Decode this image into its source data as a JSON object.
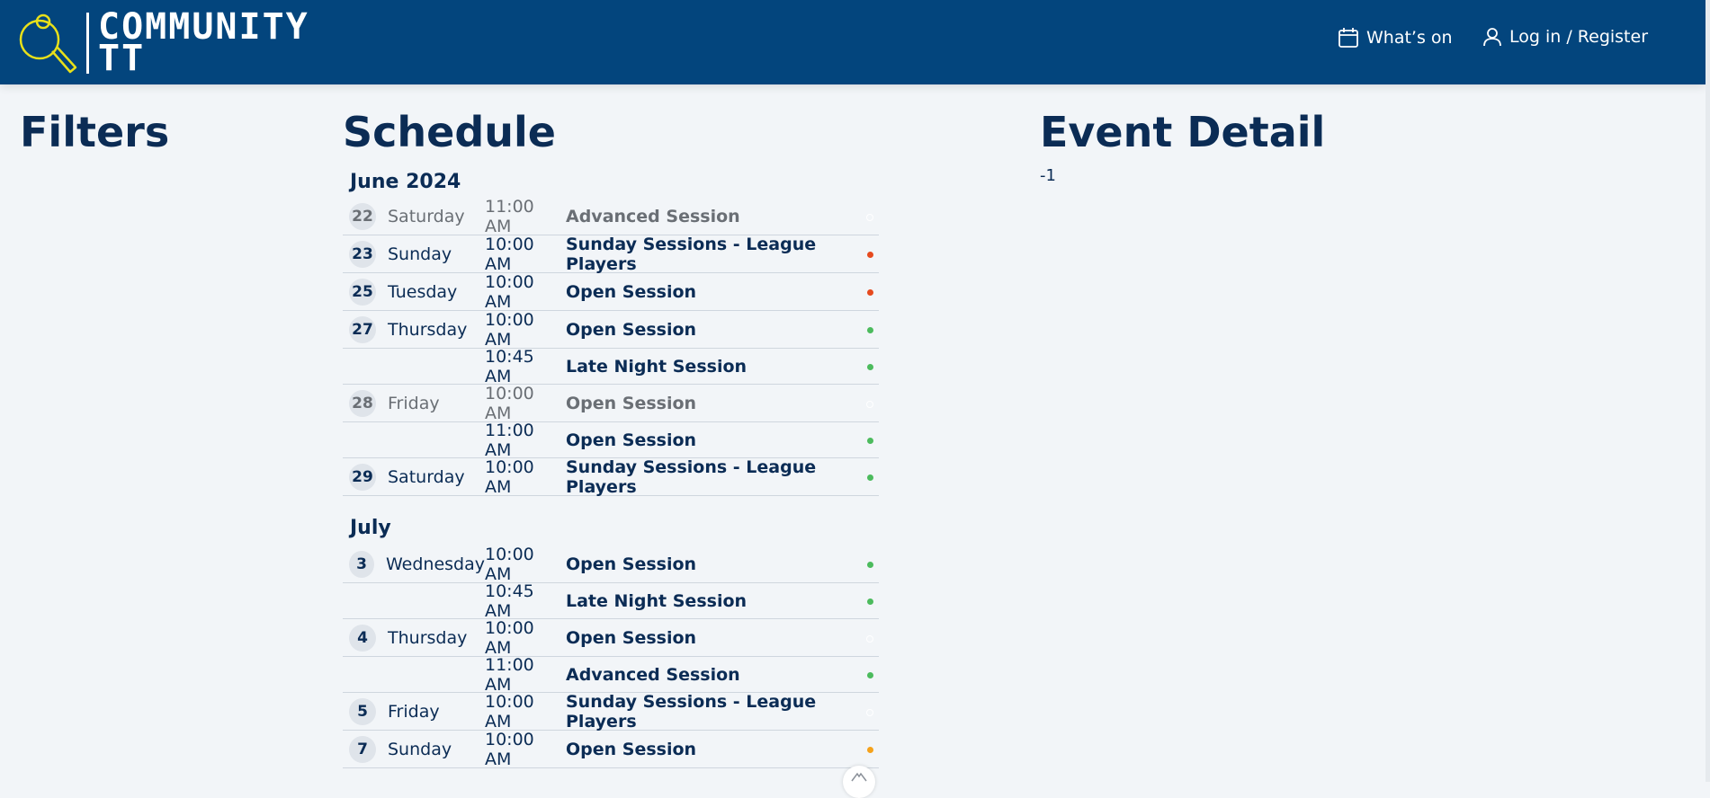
{
  "header": {
    "brand_line1": "COMMUNITY",
    "brand_line2": "TT",
    "nav_whats_on": "What’s on",
    "nav_login": "Log in / Register",
    "colors": {
      "bar": "#03457d",
      "logo": "#e8e01a"
    }
  },
  "filters": {
    "title": "Filters"
  },
  "schedule": {
    "title": "Schedule",
    "months": [
      {
        "label": "June 2024",
        "rows": [
          {
            "day": "22",
            "weekday": "Saturday",
            "time": "11:00 AM",
            "event": "Advanced Session",
            "status": "open",
            "faded": true
          },
          {
            "day": "23",
            "weekday": "Sunday",
            "time": "10:00 AM",
            "event": "Sunday Sessions - League Players",
            "status": "red",
            "faded": false
          },
          {
            "day": "25",
            "weekday": "Tuesday",
            "time": "10:00 AM",
            "event": "Open Session",
            "status": "red",
            "faded": false
          },
          {
            "day": "27",
            "weekday": "Thursday",
            "time": "10:00 AM",
            "event": "Open Session",
            "status": "green",
            "faded": false
          },
          {
            "day": "",
            "weekday": "",
            "time": "10:45 AM",
            "event": "Late Night Session",
            "status": "green",
            "faded": false
          },
          {
            "day": "28",
            "weekday": "Friday",
            "time": "10:00 AM",
            "event": "Open Session",
            "status": "open",
            "faded": true
          },
          {
            "day": "",
            "weekday": "",
            "time": "11:00 AM",
            "event": "Open Session",
            "status": "green",
            "faded": false
          },
          {
            "day": "29",
            "weekday": "Saturday",
            "time": "10:00 AM",
            "event": "Sunday Sessions - League Players",
            "status": "green",
            "faded": false
          }
        ]
      },
      {
        "label": "July",
        "rows": [
          {
            "day": "3",
            "weekday": "Wednesday",
            "time": "10:00 AM",
            "event": "Open Session",
            "status": "green",
            "faded": false
          },
          {
            "day": "",
            "weekday": "",
            "time": "10:45 AM",
            "event": "Late Night Session",
            "status": "green",
            "faded": false
          },
          {
            "day": "4",
            "weekday": "Thursday",
            "time": "10:00 AM",
            "event": "Open Session",
            "status": "open",
            "faded": false
          },
          {
            "day": "",
            "weekday": "",
            "time": "11:00 AM",
            "event": "Advanced Session",
            "status": "green",
            "faded": false
          },
          {
            "day": "5",
            "weekday": "Friday",
            "time": "10:00 AM",
            "event": "Sunday Sessions - League Players",
            "status": "open",
            "faded": false
          },
          {
            "day": "7",
            "weekday": "Sunday",
            "time": "10:00 AM",
            "event": "Open Session",
            "status": "orange",
            "faded": false
          }
        ]
      }
    ]
  },
  "event_detail": {
    "title": "Event Detail",
    "value": "-1"
  }
}
